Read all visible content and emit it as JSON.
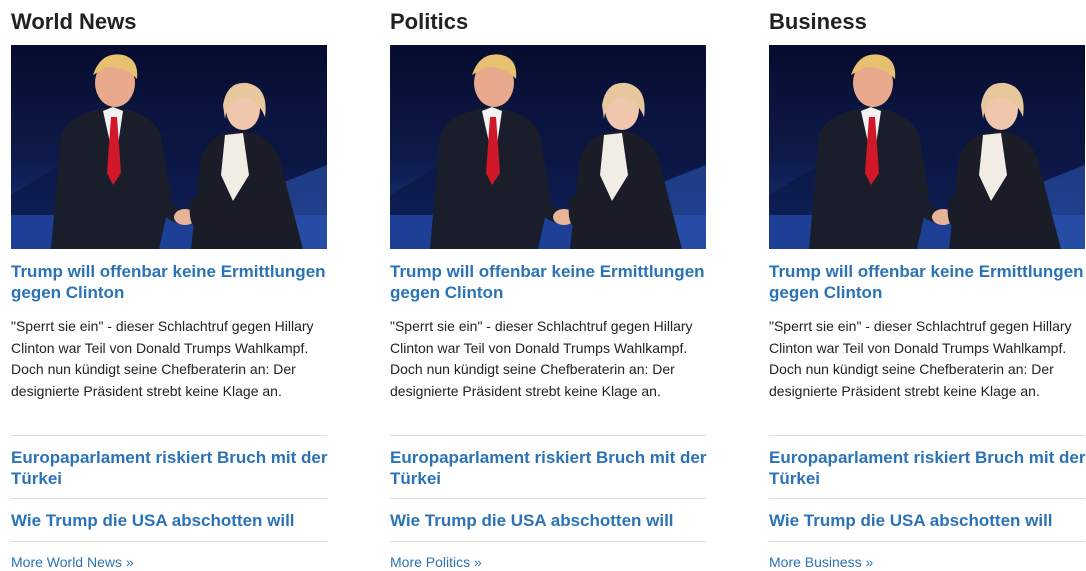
{
  "columns": [
    {
      "title": "World News",
      "lead": {
        "headline": "Trump will offenbar keine Ermittlungen gegen Clinton",
        "summary": "\"Sperrt sie ein\" - dieser Schlachtruf gegen Hillary Clinton war Teil von Donald Trumps Wahlkampf. Doch nun kündigt seine Chefberaterin an: Der designierte Präsident strebt keine Klage an."
      },
      "stories": [
        "Europaparlament riskiert Bruch mit der Türkei",
        "Wie Trump die USA abschotten will"
      ],
      "more": "More World News »"
    },
    {
      "title": "Politics",
      "lead": {
        "headline": "Trump will offenbar keine Ermittlungen gegen Clinton",
        "summary": "\"Sperrt sie ein\" - dieser Schlachtruf gegen Hillary Clinton war Teil von Donald Trumps Wahlkampf. Doch nun kündigt seine Chefberaterin an: Der designierte Präsident strebt keine Klage an."
      },
      "stories": [
        "Europaparlament riskiert Bruch mit der Türkei",
        "Wie Trump die USA abschotten will"
      ],
      "more": "More Politics »"
    },
    {
      "title": "Business",
      "lead": {
        "headline": "Trump will offenbar keine Ermittlungen gegen Clinton",
        "summary": "\"Sperrt sie ein\" - dieser Schlachtruf gegen Hillary Clinton war Teil von Donald Trumps Wahlkampf. Doch nun kündigt seine Chefberaterin an: Der designierte Präsident strebt keine Klage an."
      },
      "stories": [
        "Europaparlament riskiert Bruch mit der Türkei",
        "Wie Trump die USA abschotten will"
      ],
      "more": "More Business »"
    }
  ],
  "colors": {
    "link": "#2b73b6",
    "heading": "#222222",
    "body_text": "#222222",
    "divider": "#dddddd",
    "photo_background": "#0e1a4a"
  }
}
